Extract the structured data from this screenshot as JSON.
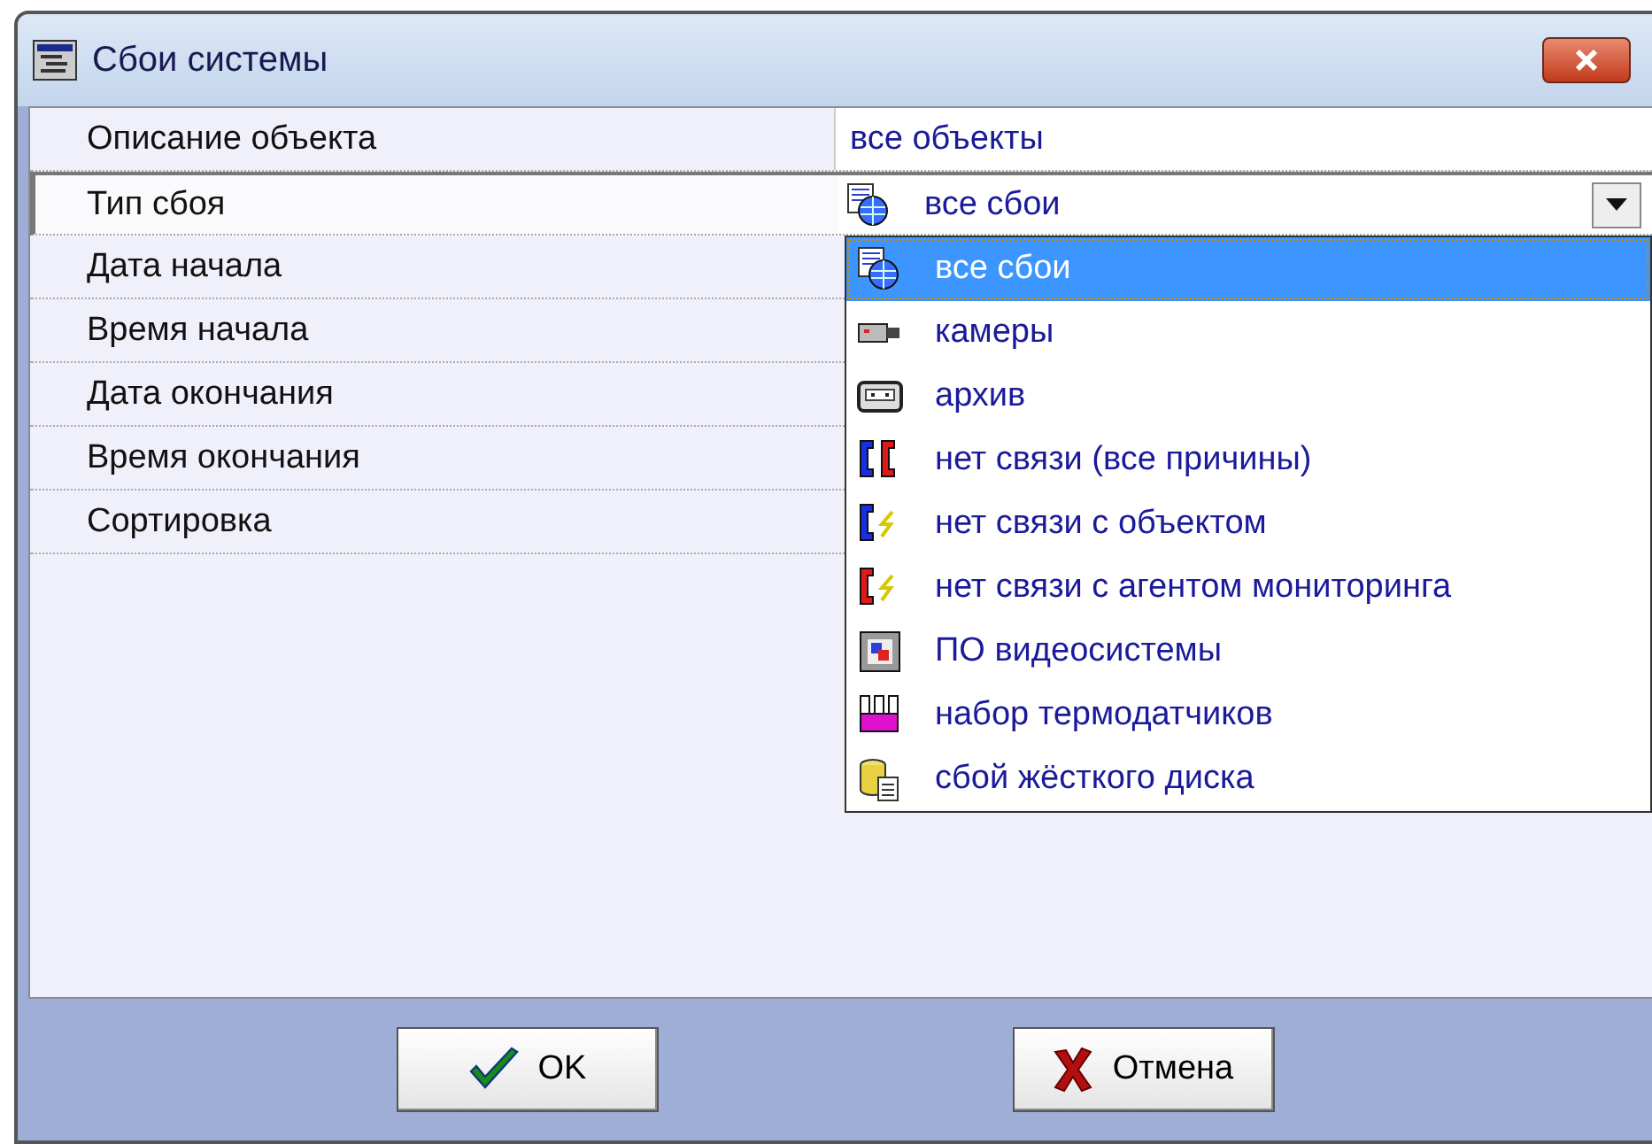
{
  "window": {
    "title": "Сбои системы"
  },
  "properties": [
    {
      "label": "Описание объекта",
      "value": "все объекты",
      "selected": false
    },
    {
      "label": "Тип сбоя",
      "value": "все сбои",
      "kind": "all",
      "selected": true
    },
    {
      "label": "Дата начала",
      "selected": false
    },
    {
      "label": "Время начала",
      "selected": false
    },
    {
      "label": "Дата окончания",
      "selected": false
    },
    {
      "label": "Время окончания",
      "selected": false
    },
    {
      "label": "Сортировка",
      "selected": false
    }
  ],
  "dropdown": [
    {
      "label": "все сбои",
      "kind": "all",
      "selected": true
    },
    {
      "label": "камеры",
      "kind": "camera",
      "selected": false
    },
    {
      "label": "архив",
      "kind": "archive",
      "selected": false
    },
    {
      "label": "нет связи (все причины)",
      "kind": "link-all",
      "selected": false
    },
    {
      "label": "нет связи с объектом",
      "kind": "link-object",
      "selected": false
    },
    {
      "label": "нет связи с агентом мониторинга",
      "kind": "link-agent",
      "selected": false
    },
    {
      "label": "ПО видеосистемы",
      "kind": "software",
      "selected": false
    },
    {
      "label": "набор термодатчиков",
      "kind": "thermo",
      "selected": false
    },
    {
      "label": "сбой жёсткого диска",
      "kind": "disk",
      "selected": false
    }
  ],
  "buttons": [
    {
      "label": "OK",
      "kind": "ok"
    },
    {
      "label": "Отмена",
      "kind": "cancel"
    }
  ]
}
